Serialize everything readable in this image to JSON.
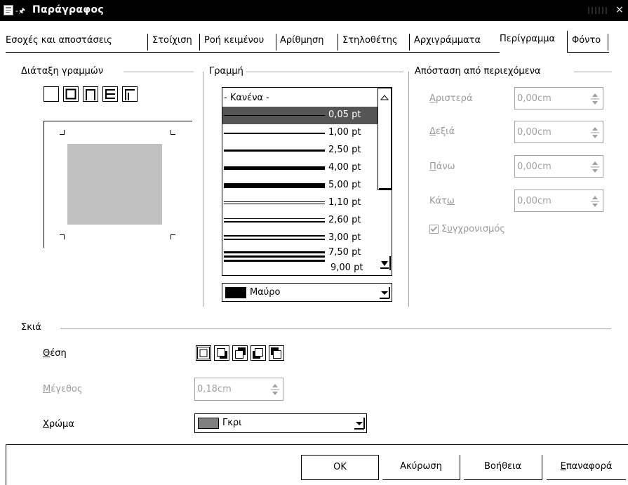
{
  "window": {
    "title": "Παράγραφος",
    "close_glyph": "×",
    "pin_glyph": "-🖈"
  },
  "tabs": [
    {
      "label": "Εσοχές και αποστάσεις"
    },
    {
      "label": "Στοίχιση"
    },
    {
      "label": "Ροή κειμένου"
    },
    {
      "label": "Αρίθμηση"
    },
    {
      "label": "Στηλοθέτης"
    },
    {
      "label": "Αρχιγράμματα"
    },
    {
      "label": "Περίγραμμα",
      "active": true
    },
    {
      "label": "Φόντο"
    }
  ],
  "line_arrangement": {
    "legend": "Διάταξη γραμμών"
  },
  "line": {
    "legend": "Γραμμή",
    "styles": [
      {
        "label": "- Κανένα -"
      },
      {
        "label": "0,05 pt",
        "selected": true
      },
      {
        "label": "1,00 pt"
      },
      {
        "label": "2,50 pt"
      },
      {
        "label": "4,00 pt"
      },
      {
        "label": "5,00 pt"
      },
      {
        "label": "1,10 pt"
      },
      {
        "label": "2,60 pt"
      },
      {
        "label": "3,00 pt"
      },
      {
        "label": "7,50 pt"
      },
      {
        "label": "9,00 pt"
      }
    ],
    "color": {
      "label": "Μαύρο",
      "swatch": "#000000"
    }
  },
  "spacing": {
    "legend": "Απόσταση από περιεχόμενα",
    "left": {
      "label_pre": "",
      "label_u": "Α",
      "label_post": "ριστερά",
      "value": "0,00cm"
    },
    "right": {
      "label_pre": "",
      "label_u": "Δ",
      "label_post": "εξιά",
      "value": "0,00cm"
    },
    "top": {
      "label_pre": "",
      "label_u": "Π",
      "label_post": "άνω",
      "value": "0,00cm"
    },
    "bottom": {
      "label_pre": "Κάτ",
      "label_u": "ω",
      "label_post": "",
      "value": "0,00cm"
    },
    "sync": {
      "label_pre": "Σ",
      "label_u": "υ",
      "label_post": "γχρονισμός",
      "checked": true
    }
  },
  "shadow": {
    "legend": "Σκιά",
    "position": {
      "label_u": "Θ",
      "label_post": "έση"
    },
    "size": {
      "label_u": "Μ",
      "label_post": "έγεθος",
      "value": "0,18cm"
    },
    "color": {
      "label_u": "Χ",
      "label_post": "ρώμα",
      "value": "Γκρι",
      "swatch": "#808080"
    }
  },
  "buttons": {
    "ok": "OK",
    "cancel": "Ακύρωση",
    "help": "Βοήθεια",
    "reset_u": "Ε",
    "reset_post": "παναφορά"
  }
}
